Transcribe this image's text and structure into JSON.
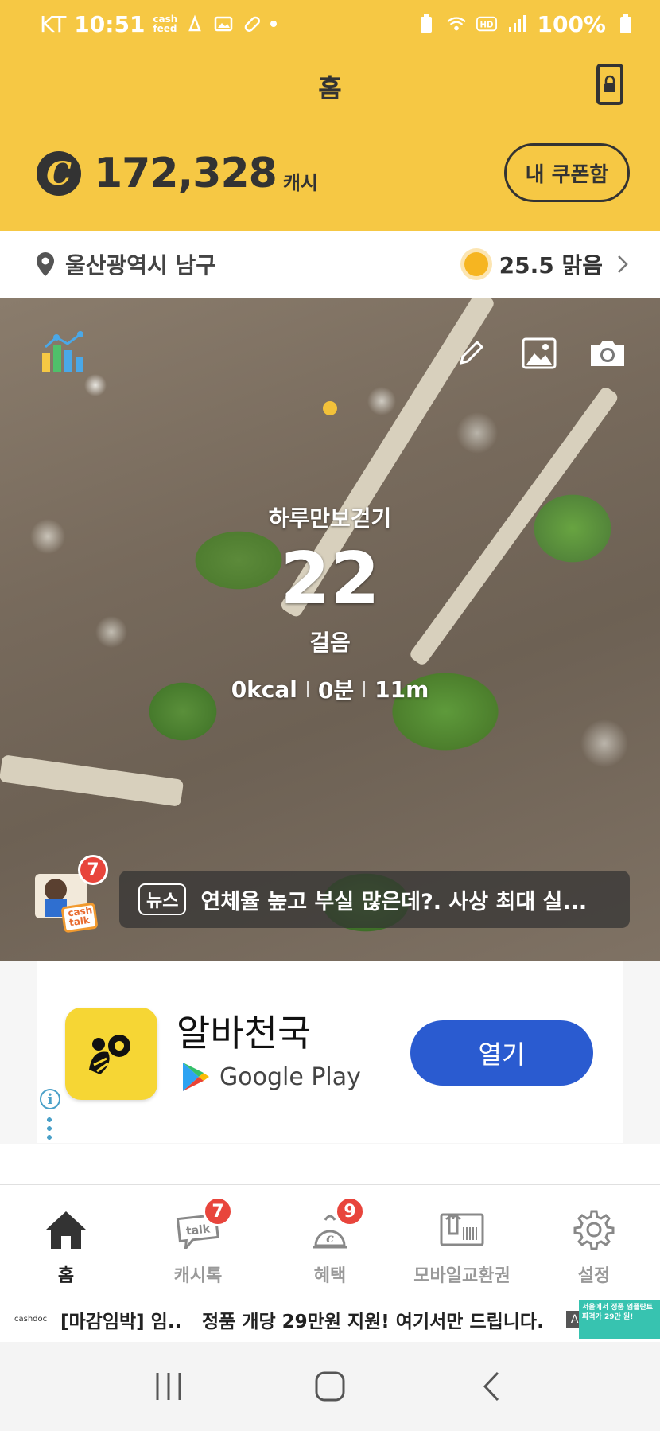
{
  "status_bar": {
    "carrier": "KT",
    "time": "10:51",
    "cashfeed_label": "cash feed",
    "battery": "100%"
  },
  "header": {
    "title": "홈",
    "cash_amount": "172,328",
    "cash_unit": "캐시",
    "coupon_button": "내 쿠폰함"
  },
  "location": {
    "place": "울산광역시 남구",
    "weather": "25.5 맑음"
  },
  "pedometer": {
    "label": "하루만보걷기",
    "steps": "22",
    "unit": "걸음",
    "kcal": "0kcal",
    "minutes": "0분",
    "distance": "11m"
  },
  "news": {
    "tag": "뉴스",
    "headline": "연체율 높고 부실 많은데?. 사상 최대 실...",
    "badge": "7",
    "avatar_text": "cash talk"
  },
  "ad": {
    "app_name": "알바천국",
    "store": "Google Play",
    "open_button": "열기",
    "info_glyph": "i"
  },
  "bottom_nav": [
    {
      "label": "홈",
      "icon": "home-icon",
      "badge": ""
    },
    {
      "label": "캐시톡",
      "icon": "talk-icon",
      "badge": "7"
    },
    {
      "label": "혜택",
      "icon": "benefit-icon",
      "badge": "9"
    },
    {
      "label": "모바일교환권",
      "icon": "voucher-icon",
      "badge": ""
    },
    {
      "label": "설정",
      "icon": "gear-icon",
      "badge": ""
    }
  ],
  "banner": {
    "logo": "cashdoc",
    "text1": "[마감임박] 임...",
    "text2": "정품 개당 29만원 지원! 여기서만 드립니다.",
    "ad_label": "AD",
    "thumb_text": "서울에서 정품 임플란트 파격가 29만 원!"
  },
  "colors": {
    "brand_yellow": "#f6c844",
    "open_button_blue": "#2a5bd0",
    "badge_red": "#e8453c"
  }
}
